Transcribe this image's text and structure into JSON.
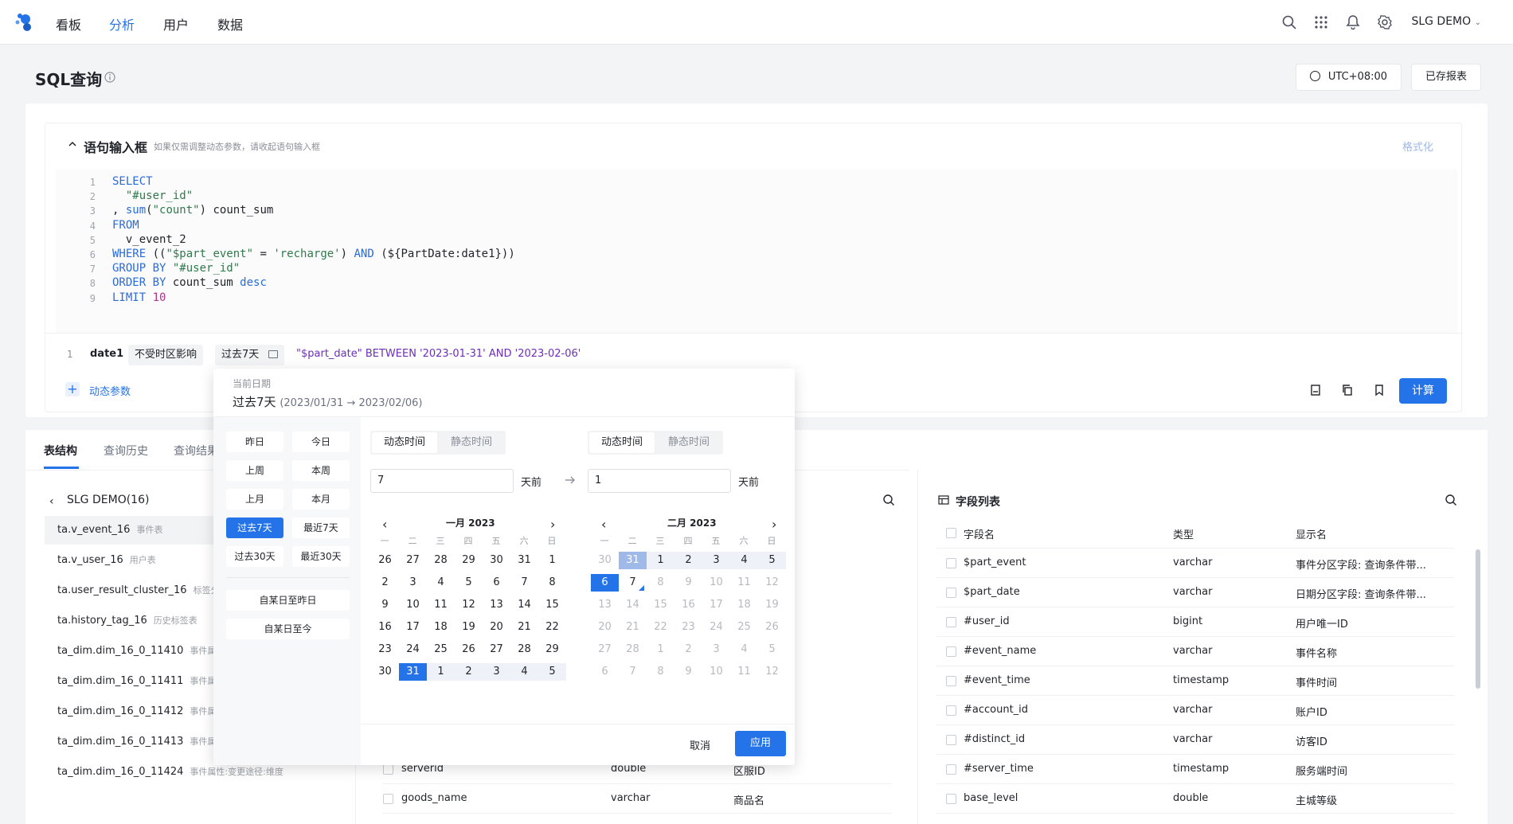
{
  "nav": {
    "items": [
      "看板",
      "分析",
      "用户",
      "数据"
    ],
    "project": "SLG DEMO"
  },
  "header": {
    "title": "SQL查询",
    "timezone": "UTC+08:00",
    "saved_reports": "已存报表"
  },
  "editor": {
    "label": "语句输入框",
    "hint": "如果仅需调整动态参数，请收起语句输入框",
    "format": "格式化",
    "lines": [
      {
        "n": "1",
        "segs": [
          {
            "t": "SELECT",
            "c": "kw"
          }
        ]
      },
      {
        "n": "2",
        "segs": [
          {
            "t": "  \"#user_id\"",
            "c": "st"
          }
        ]
      },
      {
        "n": "3",
        "segs": [
          {
            "t": ", ",
            "c": ""
          },
          {
            "t": "sum",
            "c": "kw"
          },
          {
            "t": "(",
            "c": ""
          },
          {
            "t": "\"count\"",
            "c": "st"
          },
          {
            "t": ") count_sum",
            "c": ""
          }
        ]
      },
      {
        "n": "4",
        "segs": [
          {
            "t": "FROM",
            "c": "kw"
          }
        ]
      },
      {
        "n": "5",
        "segs": [
          {
            "t": "  v_event_2",
            "c": ""
          }
        ]
      },
      {
        "n": "6",
        "segs": [
          {
            "t": "WHERE",
            "c": "kw"
          },
          {
            "t": " ((",
            "c": ""
          },
          {
            "t": "\"$part_event\"",
            "c": "st"
          },
          {
            "t": " = ",
            "c": ""
          },
          {
            "t": "'recharge'",
            "c": "st"
          },
          {
            "t": ") ",
            "c": ""
          },
          {
            "t": "AND",
            "c": "kw"
          },
          {
            "t": " (${PartDate:date1}))",
            "c": ""
          }
        ]
      },
      {
        "n": "7",
        "segs": [
          {
            "t": "GROUP BY",
            "c": "kw"
          },
          {
            "t": " ",
            "c": ""
          },
          {
            "t": "\"#user_id\"",
            "c": "st"
          }
        ]
      },
      {
        "n": "8",
        "segs": [
          {
            "t": "ORDER BY",
            "c": "kw"
          },
          {
            "t": " count_sum ",
            "c": ""
          },
          {
            "t": "desc",
            "c": "kw"
          }
        ]
      },
      {
        "n": "9",
        "segs": [
          {
            "t": "LIMIT",
            "c": "kw"
          },
          {
            "t": " ",
            "c": ""
          },
          {
            "t": "10",
            "c": "nm"
          }
        ]
      }
    ]
  },
  "param": {
    "index": "1",
    "name": "date1",
    "tz_tag": "不受时区影响",
    "range_tag": "过去7天",
    "sql": "\"$part_date\" BETWEEN '2023-01-31' AND '2023-02-06'",
    "add_label": "动态参数",
    "calc": "计算"
  },
  "bottom_tabs": [
    "表结构",
    "查询历史",
    "查询结果"
  ],
  "db": {
    "name": "SLG DEMO(16)"
  },
  "tables": [
    {
      "name": "ta.v_event_16",
      "tag": "事件表"
    },
    {
      "name": "ta.v_user_16",
      "tag": "用户表"
    },
    {
      "name": "ta.user_result_cluster_16",
      "tag": "标签分"
    },
    {
      "name": "ta.history_tag_16",
      "tag": "历史标签表"
    },
    {
      "name": "ta_dim.dim_16_0_11410",
      "tag": "事件属"
    },
    {
      "name": "ta_dim.dim_16_0_11411",
      "tag": "事件属"
    },
    {
      "name": "ta_dim.dim_16_0_11412",
      "tag": "事件属"
    },
    {
      "name": "ta_dim.dim_16_0_11413",
      "tag": "事件属"
    },
    {
      "name": "ta_dim.dim_16_0_11424",
      "tag": "事件属性:变更途径:维度"
    }
  ],
  "mid_rows": [
    {
      "name": "serverid",
      "type": "double",
      "display": "区服ID"
    },
    {
      "name": "goods_name",
      "type": "varchar",
      "display": "商品名"
    }
  ],
  "fields": {
    "title": "字段列表",
    "headers": [
      "字段名",
      "类型",
      "显示名"
    ],
    "rows": [
      {
        "name": "$part_event",
        "type": "varchar",
        "display": "事件分区字段: 查询条件带..."
      },
      {
        "name": "$part_date",
        "type": "varchar",
        "display": "日期分区字段: 查询条件带..."
      },
      {
        "name": "#user_id",
        "type": "bigint",
        "display": "用户唯一ID"
      },
      {
        "name": "#event_name",
        "type": "varchar",
        "display": "事件名称"
      },
      {
        "name": "#event_time",
        "type": "timestamp",
        "display": "事件时间"
      },
      {
        "name": "#account_id",
        "type": "varchar",
        "display": "账户ID"
      },
      {
        "name": "#distinct_id",
        "type": "varchar",
        "display": "访客ID"
      },
      {
        "name": "#server_time",
        "type": "timestamp",
        "display": "服务端时间"
      },
      {
        "name": "base_level",
        "type": "double",
        "display": "主城等级"
      }
    ]
  },
  "popup": {
    "current_label": "当前日期",
    "current_value": "过去7天",
    "current_range": "(2023/01/31 → 2023/02/06)",
    "quick": [
      "昨日",
      "今日",
      "上周",
      "本周",
      "上月",
      "本月",
      "过去7天",
      "最近7天",
      "过去30天",
      "最近30天"
    ],
    "quick_selected": "过去7天",
    "quick_wide": [
      "自某日至昨日",
      "自某日至今"
    ],
    "seg_dynamic": "动态时间",
    "seg_static": "静态时间",
    "start_value": "7",
    "end_value": "1",
    "unit": "天前",
    "weekdays": [
      "一",
      "二",
      "三",
      "四",
      "五",
      "六",
      "日"
    ],
    "cal1": {
      "title": "一月 2023",
      "days": [
        {
          "d": "26"
        },
        {
          "d": "27"
        },
        {
          "d": "28"
        },
        {
          "d": "29"
        },
        {
          "d": "30"
        },
        {
          "d": "31"
        },
        {
          "d": "1"
        },
        {
          "d": "2"
        },
        {
          "d": "3"
        },
        {
          "d": "4"
        },
        {
          "d": "5"
        },
        {
          "d": "6"
        },
        {
          "d": "7"
        },
        {
          "d": "8"
        },
        {
          "d": "9"
        },
        {
          "d": "10"
        },
        {
          "d": "11"
        },
        {
          "d": "12"
        },
        {
          "d": "13"
        },
        {
          "d": "14"
        },
        {
          "d": "15"
        },
        {
          "d": "16"
        },
        {
          "d": "17"
        },
        {
          "d": "18"
        },
        {
          "d": "19"
        },
        {
          "d": "20"
        },
        {
          "d": "21"
        },
        {
          "d": "22"
        },
        {
          "d": "23"
        },
        {
          "d": "24"
        },
        {
          "d": "25"
        },
        {
          "d": "26"
        },
        {
          "d": "27"
        },
        {
          "d": "28"
        },
        {
          "d": "29"
        },
        {
          "d": "30"
        },
        {
          "d": "31",
          "s": "sel"
        },
        {
          "d": "1",
          "s": "inrange"
        },
        {
          "d": "2",
          "s": "inrange"
        },
        {
          "d": "3",
          "s": "inrange"
        },
        {
          "d": "4",
          "s": "inrange"
        },
        {
          "d": "5",
          "s": "inrange"
        }
      ]
    },
    "cal2": {
      "title": "二月 2023",
      "days": [
        {
          "d": "30",
          "s": "off"
        },
        {
          "d": "31",
          "s": "hl"
        },
        {
          "d": "1",
          "s": "inrange"
        },
        {
          "d": "2",
          "s": "inrange"
        },
        {
          "d": "3",
          "s": "inrange"
        },
        {
          "d": "4",
          "s": "inrange"
        },
        {
          "d": "5",
          "s": "inrange"
        },
        {
          "d": "6",
          "s": "sel"
        },
        {
          "d": "7",
          "s": "today"
        },
        {
          "d": "8",
          "s": "off"
        },
        {
          "d": "9",
          "s": "off"
        },
        {
          "d": "10",
          "s": "off"
        },
        {
          "d": "11",
          "s": "off"
        },
        {
          "d": "12",
          "s": "off"
        },
        {
          "d": "13",
          "s": "off"
        },
        {
          "d": "14",
          "s": "off"
        },
        {
          "d": "15",
          "s": "off"
        },
        {
          "d": "16",
          "s": "off"
        },
        {
          "d": "17",
          "s": "off"
        },
        {
          "d": "18",
          "s": "off"
        },
        {
          "d": "19",
          "s": "off"
        },
        {
          "d": "20",
          "s": "off"
        },
        {
          "d": "21",
          "s": "off"
        },
        {
          "d": "22",
          "s": "off"
        },
        {
          "d": "23",
          "s": "off"
        },
        {
          "d": "24",
          "s": "off"
        },
        {
          "d": "25",
          "s": "off"
        },
        {
          "d": "26",
          "s": "off"
        },
        {
          "d": "27",
          "s": "off"
        },
        {
          "d": "28",
          "s": "off"
        },
        {
          "d": "1",
          "s": "off"
        },
        {
          "d": "2",
          "s": "off"
        },
        {
          "d": "3",
          "s": "off"
        },
        {
          "d": "4",
          "s": "off"
        },
        {
          "d": "5",
          "s": "off"
        },
        {
          "d": "6",
          "s": "off"
        },
        {
          "d": "7",
          "s": "off"
        },
        {
          "d": "8",
          "s": "off"
        },
        {
          "d": "9",
          "s": "off"
        },
        {
          "d": "10",
          "s": "off"
        },
        {
          "d": "11",
          "s": "off"
        },
        {
          "d": "12",
          "s": "off"
        }
      ]
    },
    "cancel": "取消",
    "apply": "应用"
  },
  "colors": {
    "accent": "#2473e8"
  }
}
